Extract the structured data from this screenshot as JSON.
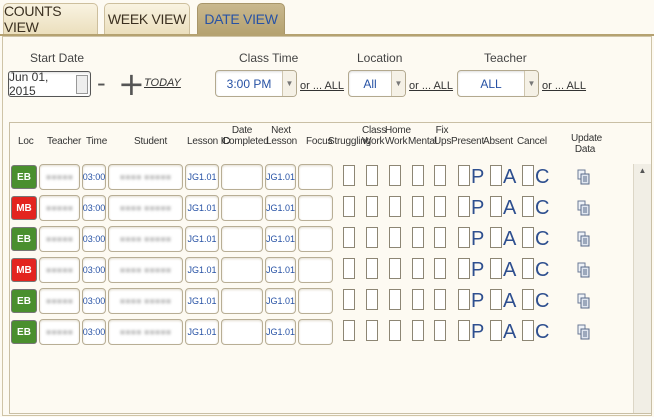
{
  "tabs": [
    {
      "label": "COUNTS VIEW",
      "active": false
    },
    {
      "label": "WEEK VIEW",
      "active": false
    },
    {
      "label": "DATE VIEW",
      "active": true
    }
  ],
  "filters": {
    "start_date": {
      "label": "Start Date",
      "value": "Jun 01, 2015"
    },
    "minus_symbol": "-",
    "plus_symbol": "+",
    "today_link": "TODAY",
    "class_time": {
      "label": "Class Time",
      "value": "3:00 PM",
      "or_all": "or ... ALL"
    },
    "location": {
      "label": "Location",
      "value": "All",
      "or_all": "or ... ALL"
    },
    "teacher": {
      "label": "Teacher",
      "value": "ALL",
      "or_all": "or ... ALL"
    }
  },
  "grid": {
    "headers": {
      "loc": "Loc",
      "teacher": "Teacher",
      "time": "Time",
      "student": "Student",
      "lesson_id": "Lesson ID",
      "date_completed": "Date Completed",
      "next_lesson": "Next Lesson",
      "focus": "Focus",
      "struggling": "Struggling",
      "class_work": "Class Work",
      "home_work": "Home Work",
      "mental": "Mental",
      "fix_ups": "Fix Ups",
      "present": "Present",
      "absent": "Absent",
      "cancel": "Cancel",
      "update_data": "Update Data"
    },
    "rows": [
      {
        "loc": "EB",
        "loc_color": "#4a8f2e",
        "time": "03:00",
        "lesson_id": "JG1.01",
        "next_lesson": "JG1.01"
      },
      {
        "loc": "MB",
        "loc_color": "#e3241f",
        "time": "03:00",
        "lesson_id": "JG1.01",
        "next_lesson": "JG1.01"
      },
      {
        "loc": "EB",
        "loc_color": "#4a8f2e",
        "time": "03:00",
        "lesson_id": "JG1.01",
        "next_lesson": "JG1.01"
      },
      {
        "loc": "MB",
        "loc_color": "#e3241f",
        "time": "03:00",
        "lesson_id": "JG1.01",
        "next_lesson": "JG1.01"
      },
      {
        "loc": "EB",
        "loc_color": "#4a8f2e",
        "time": "03:00",
        "lesson_id": "JG1.01",
        "next_lesson": "JG1.01"
      },
      {
        "loc": "EB",
        "loc_color": "#4a8f2e",
        "time": "03:00",
        "lesson_id": "JG1.01",
        "next_lesson": "JG1.01"
      }
    ],
    "present_letter": "P",
    "absent_letter": "A",
    "cancel_letter": "C"
  },
  "icons": {
    "date_picker": "calendar-icon",
    "update": "update-data-icon",
    "dropdown": "chevron-down-icon",
    "scroll_up": "scroll-up-icon"
  }
}
